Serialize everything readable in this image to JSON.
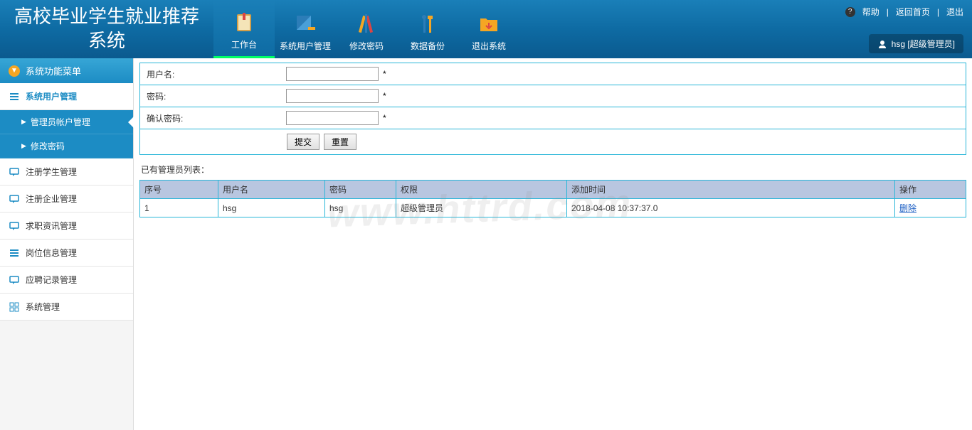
{
  "header": {
    "title": "高校毕业学生就业推荐系统",
    "help": "帮助",
    "home": "返回首页",
    "logout": "退出",
    "user": "hsg [超级管理员]"
  },
  "topnav": [
    {
      "label": "工作台"
    },
    {
      "label": "系统用户管理"
    },
    {
      "label": "修改密码"
    },
    {
      "label": "数据备份"
    },
    {
      "label": "退出系统"
    }
  ],
  "sidebar": {
    "header": "系统功能菜单",
    "items": [
      {
        "label": "系统用户管理"
      },
      {
        "label": "注册学生管理"
      },
      {
        "label": "注册企业管理"
      },
      {
        "label": "求职资讯管理"
      },
      {
        "label": "岗位信息管理"
      },
      {
        "label": "应聘记录管理"
      },
      {
        "label": "系统管理"
      }
    ],
    "submenu": [
      {
        "label": "管理员帐户管理"
      },
      {
        "label": "修改密码"
      }
    ]
  },
  "form": {
    "username_label": "用户名:",
    "password_label": "密码:",
    "confirm_label": "确认密码:",
    "asterisk": "*",
    "submit": "提交",
    "reset": "重置"
  },
  "table": {
    "title": "已有管理员列表：",
    "headers": {
      "seq": "序号",
      "username": "用户名",
      "password": "密码",
      "role": "权限",
      "time": "添加时间",
      "action": "操作"
    },
    "rows": [
      {
        "seq": "1",
        "username": "hsg",
        "password": "hsg",
        "role": "超级管理员",
        "time": "2018-04-08 10:37:37.0",
        "action": "删除"
      }
    ]
  },
  "watermark": "www.httrd.com"
}
